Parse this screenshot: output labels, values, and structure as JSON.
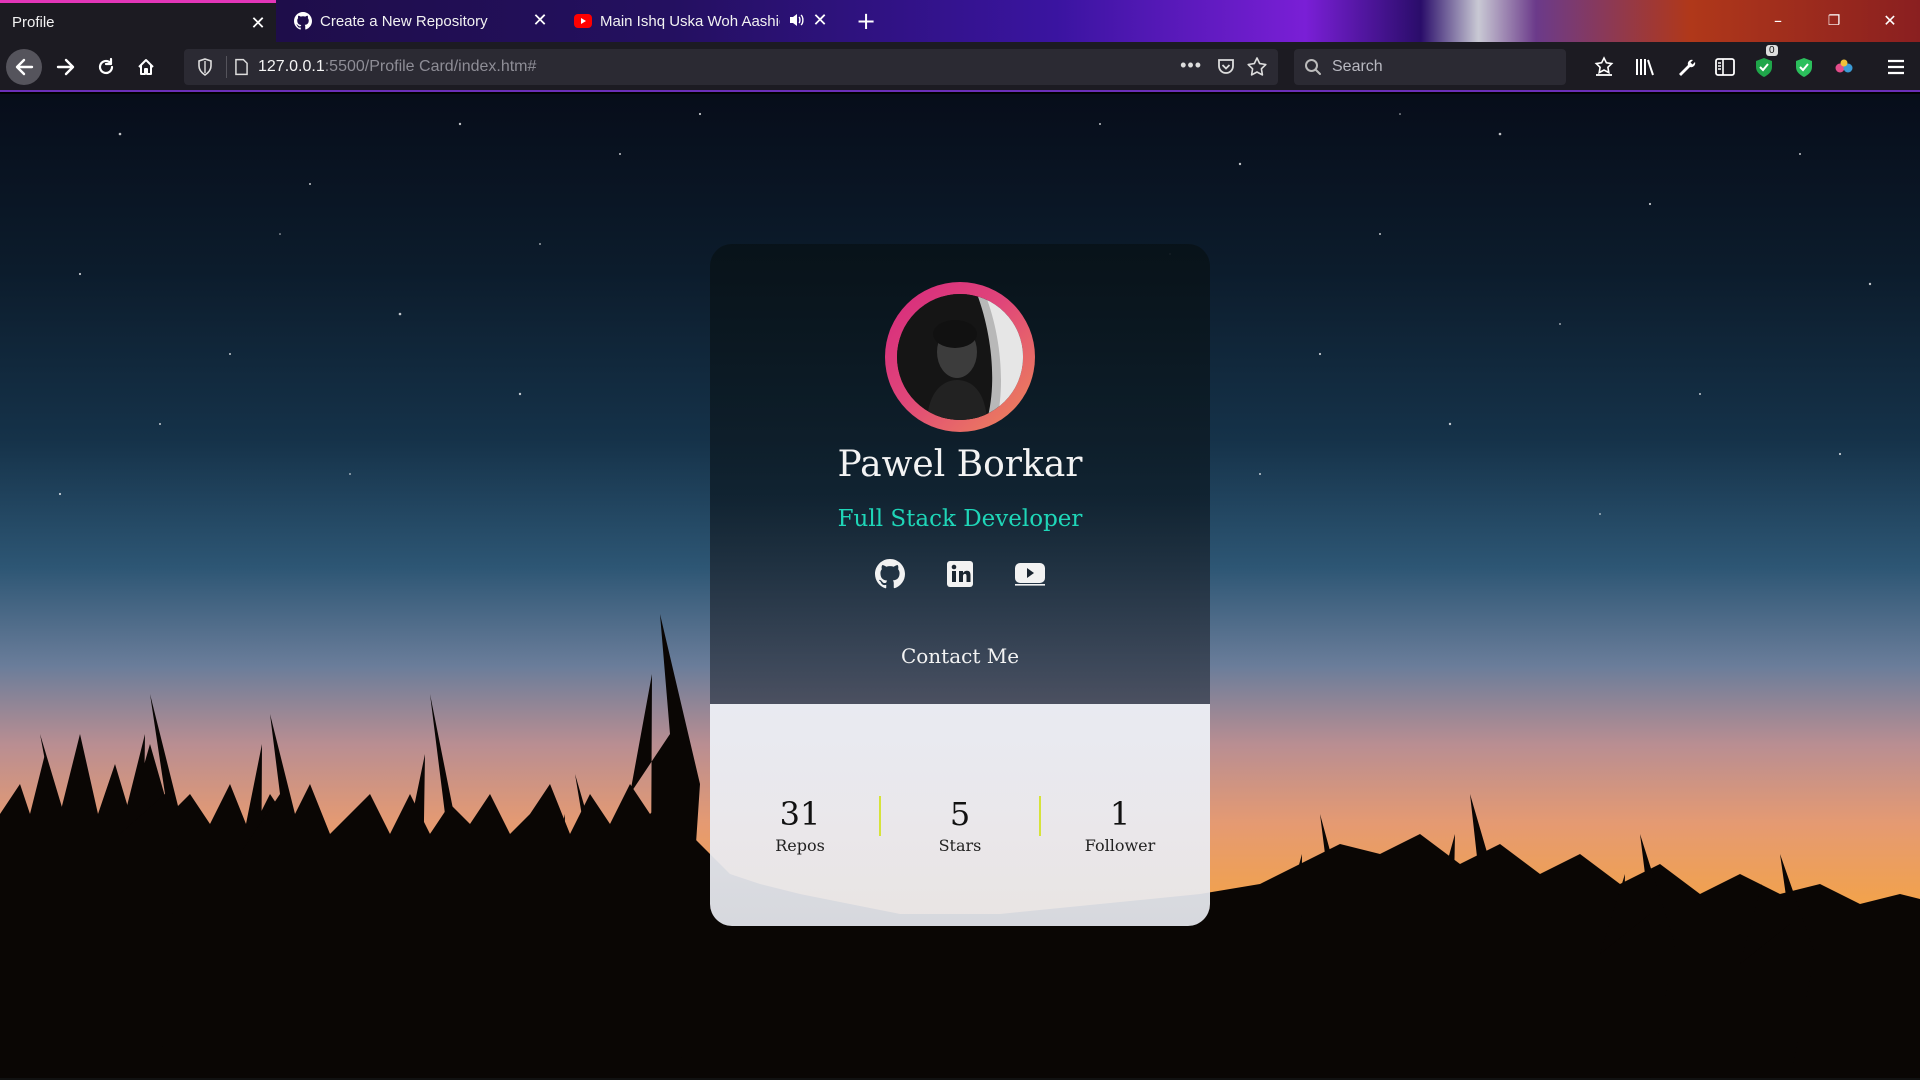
{
  "browser": {
    "tabs": [
      {
        "label": "Profile",
        "icon": "none",
        "active": true
      },
      {
        "label": "Create a New Repository",
        "icon": "github-icon",
        "active": false
      },
      {
        "label": "Main Ishq Uska Woh Aashiq",
        "icon": "youtube-icon",
        "active": false,
        "audio": true
      }
    ],
    "new_tab_label": "+",
    "window_controls": {
      "minimize": "–",
      "restore": "❐",
      "close": "✕"
    },
    "url": {
      "host": "127.0.0.1",
      "path": ":5500/Profile Card/index.htm#"
    },
    "search_placeholder": "Search",
    "addon_badge": "0"
  },
  "profile": {
    "name": "Pawel Borkar",
    "role": "Full Stack Developer",
    "socials": [
      "github-icon",
      "linkedin-icon",
      "youtube-icon"
    ],
    "contact_label": "Contact Me",
    "stats": [
      {
        "value": "31",
        "label": "Repos"
      },
      {
        "value": "5",
        "label": "Stars"
      },
      {
        "value": "1",
        "label": "Follower"
      }
    ]
  },
  "colors": {
    "accent_role": "#1fd6b8",
    "avatar_ring_start": "#d6287d",
    "avatar_ring_end": "#ee8a57",
    "stat_divider": "#d6e33a"
  }
}
